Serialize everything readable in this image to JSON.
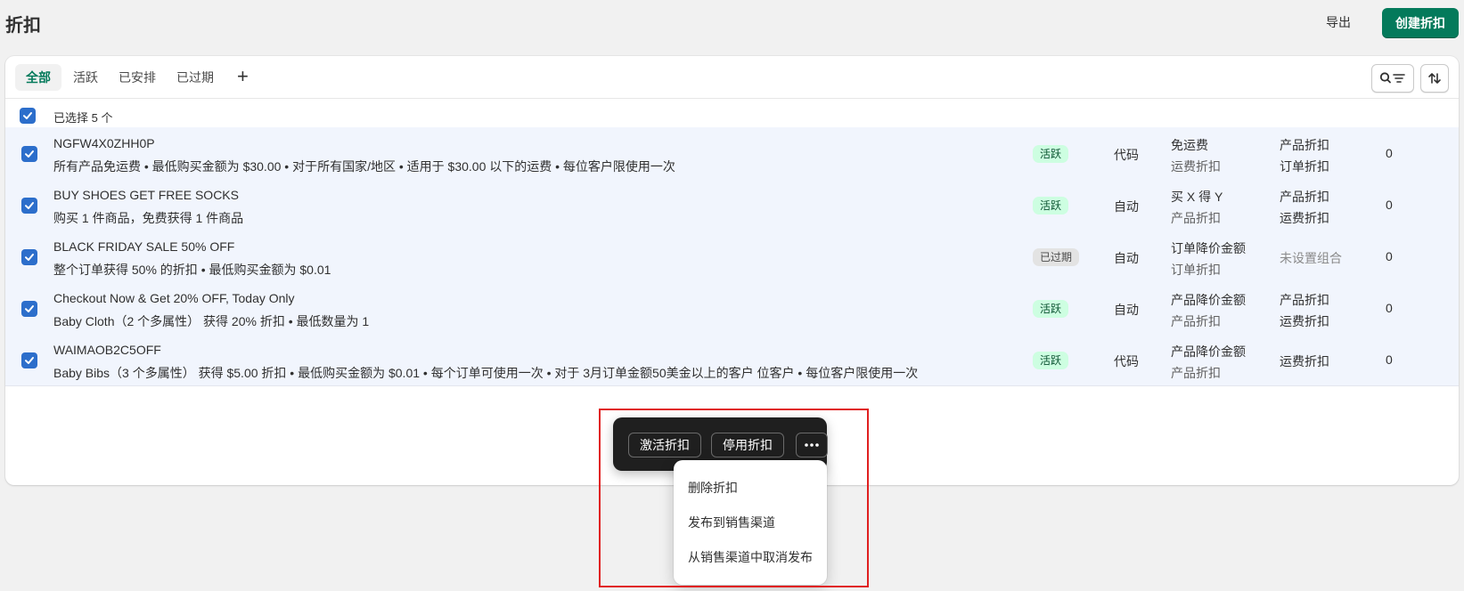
{
  "header": {
    "title": "折扣",
    "export_label": "导出",
    "create_label": "创建折扣"
  },
  "tabs": [
    {
      "label": "全部",
      "active": true
    },
    {
      "label": "活跃",
      "active": false
    },
    {
      "label": "已安排",
      "active": false
    },
    {
      "label": "已过期",
      "active": false
    }
  ],
  "tab_add_label": "+",
  "selection": {
    "label": "已选择 5 个"
  },
  "rows": [
    {
      "title": "NGFW4X0ZHH0P",
      "description": "所有产品免运费 • 最低购买金额为 $30.00 • 对于所有国家/地区 • 适用于 $30.00 以下的运费 • 每位客户限使用一次",
      "status": "活跃",
      "status_kind": "active",
      "method": "代码",
      "type_main": "免运费",
      "type_sub": "运费折扣",
      "combo": [
        "产品折扣",
        "订单折扣"
      ],
      "uses": "0"
    },
    {
      "title": "BUY SHOES GET FREE SOCKS",
      "description": "购买 1 件商品，免费获得 1 件商品",
      "status": "活跃",
      "status_kind": "active",
      "method": "自动",
      "type_main": "买 X 得 Y",
      "type_sub": "产品折扣",
      "combo": [
        "产品折扣",
        "运费折扣"
      ],
      "uses": "0"
    },
    {
      "title": "BLACK FRIDAY SALE 50% OFF",
      "description": "整个订单获得 50% 的折扣 • 最低购买金额为 $0.01",
      "status": "已过期",
      "status_kind": "expired",
      "method": "自动",
      "type_main": "订单降价金额",
      "type_sub": "订单折扣",
      "combo": [
        "未设置组合"
      ],
      "uses": "0"
    },
    {
      "title": "Checkout Now & Get 20% OFF, Today Only",
      "description": "Baby Cloth（2 个多属性） 获得 20% 折扣 • 最低数量为 1",
      "status": "活跃",
      "status_kind": "active",
      "method": "自动",
      "type_main": "产品降价金额",
      "type_sub": "产品折扣",
      "combo": [
        "产品折扣",
        "运费折扣"
      ],
      "uses": "0"
    },
    {
      "title": "WAIMAOB2C5OFF",
      "description": "Baby Bibs（3 个多属性） 获得 $5.00 折扣 • 最低购买金额为 $0.01 • 每个订单可使用一次 • 对于 3月订单金额50美金以上的客户 位客户 • 每位客户限使用一次",
      "status": "活跃",
      "status_kind": "active",
      "method": "代码",
      "type_main": "产品降价金额",
      "type_sub": "产品折扣",
      "combo": [
        "运费折扣"
      ],
      "uses": "0"
    }
  ],
  "bulk_actions": {
    "activate_label": "激活折扣",
    "deactivate_label": "停用折扣"
  },
  "more_menu": [
    "删除折扣",
    "发布到销售渠道",
    "从销售渠道中取消发布"
  ],
  "colors": {
    "primary": "#047a5b",
    "checkbox": "#2c6ecb",
    "highlight": "#e02020"
  }
}
